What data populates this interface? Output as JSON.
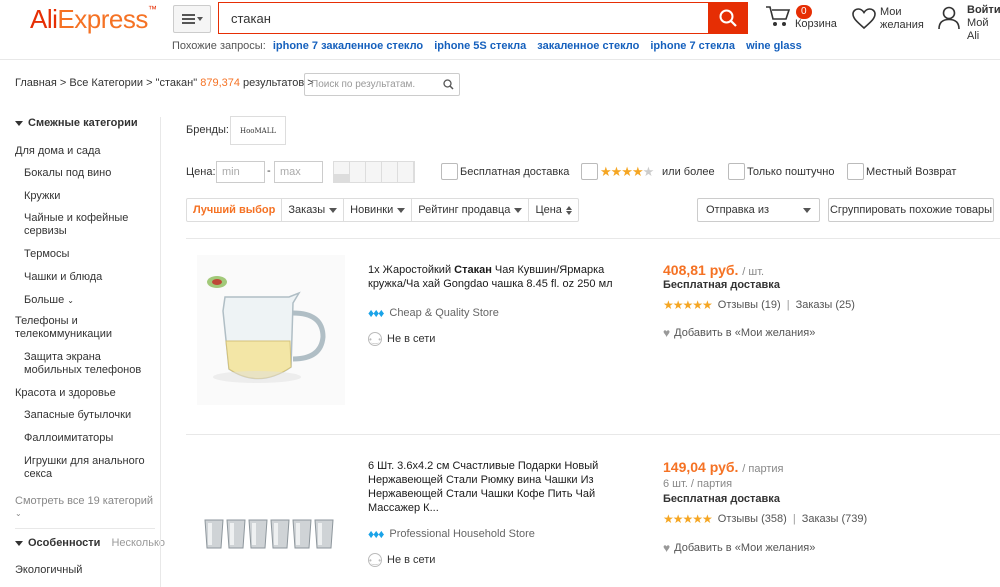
{
  "header": {
    "logo_part1": "Ali",
    "logo_part2": "Express",
    "logo_mark": "™",
    "search_value": "стакан",
    "cart_count": "0",
    "cart_label": "Корзина",
    "wish_label_1": "Мои",
    "wish_label_2": "желания",
    "account_label_1": "Войти",
    "account_label_2": "Мой Ali"
  },
  "related": {
    "label": "Похожие запросы:",
    "items": [
      "iphone 7 закаленное стекло",
      "iphone 5S стекла",
      "закаленное стекло",
      "iphone 7 стекла",
      "wine glass"
    ]
  },
  "breadcrumb": {
    "text": "Главная > Все Категории > \"стакан\"",
    "count": "879,374",
    "suffix": "результатов >",
    "in_search_placeholder": "Поиск по результатам."
  },
  "sidebar": {
    "related_header": "Смежные категории",
    "items": [
      {
        "label": "Для дома и сада",
        "top": true
      },
      {
        "label": "Бокалы под вино",
        "top": false
      },
      {
        "label": "Кружки",
        "top": false
      },
      {
        "label": "Чайные и кофейные сервизы",
        "top": false
      },
      {
        "label": "Термосы",
        "top": false
      },
      {
        "label": "Чашки и блюда",
        "top": false
      },
      {
        "label": "Больше",
        "top": false
      },
      {
        "label": "Телефоны и телекоммуникации",
        "top": true
      },
      {
        "label": "Защита экрана мобильных телефонов",
        "top": false
      },
      {
        "label": "Красота и здоровье",
        "top": true
      },
      {
        "label": "Запасные бутылочки",
        "top": false
      },
      {
        "label": "Фаллоимитаторы",
        "top": false
      },
      {
        "label": "Игрушки для анального секса",
        "top": false
      }
    ],
    "see_all": "Смотреть все 19 категорий",
    "features_header": "Особенности",
    "features_toggle": "Несколько",
    "features_first": "Экологичный"
  },
  "filters": {
    "brands_label": "Бренды:",
    "brand_name": "HooMALL",
    "price_label": "Цена:",
    "min_placeholder": "min",
    "max_placeholder": "max",
    "price_dash": "-",
    "free_shipping": "Бесплатная доставка",
    "rating_suffix": "или более",
    "single_only": "Только поштучно",
    "local_return": "Местный Возврат"
  },
  "sort": {
    "best": "Лучший выбор",
    "orders": "Заказы",
    "new": "Новинки",
    "seller_rating": "Рейтинг продавца",
    "price": "Цена",
    "ship_from": "Отправка из",
    "group_similar": "Сгруппировать похожие товары"
  },
  "products": [
    {
      "title_prefix": "1х Жаростойкий ",
      "title_bold": "Стакан",
      "title_suffix": " Чая Кувшин/Ярмарка кружка/Ча хай Gongdao чашка 8.45 fl. oz 250 мл",
      "store": "Cheap & Quality Store",
      "status": "Не в сети",
      "price": "408,81 руб.",
      "unit": "/ шт.",
      "lot": "",
      "shipping": "Бесплатная доставка",
      "reviews": "Отзывы (19)",
      "orders": "Заказы (25)",
      "wish": "Добавить в «Мои желания»"
    },
    {
      "title_prefix": "6 Шт. 3.6х4.2 см Счастливые Подарки Новый Нержавеющей Стали Рюмку вина Чашки Из Нержавеющей Стали Чашки Кофе Пить Чай Массажер К...",
      "title_bold": "",
      "title_suffix": "",
      "store": "Professional Household Store",
      "status": "Не в сети",
      "price": "149,04 руб.",
      "unit": "/ партия",
      "lot": "6 шт. / партия",
      "shipping": "Бесплатная доставка",
      "reviews": "Отзывы (358)",
      "orders": "Заказы (739)",
      "wish": "Добавить в «Мои желания»"
    }
  ],
  "colors": {
    "brand_red": "#e62e04",
    "brand_orange": "#f57224",
    "link_blue": "#1560bd",
    "star": "#f5a623"
  }
}
